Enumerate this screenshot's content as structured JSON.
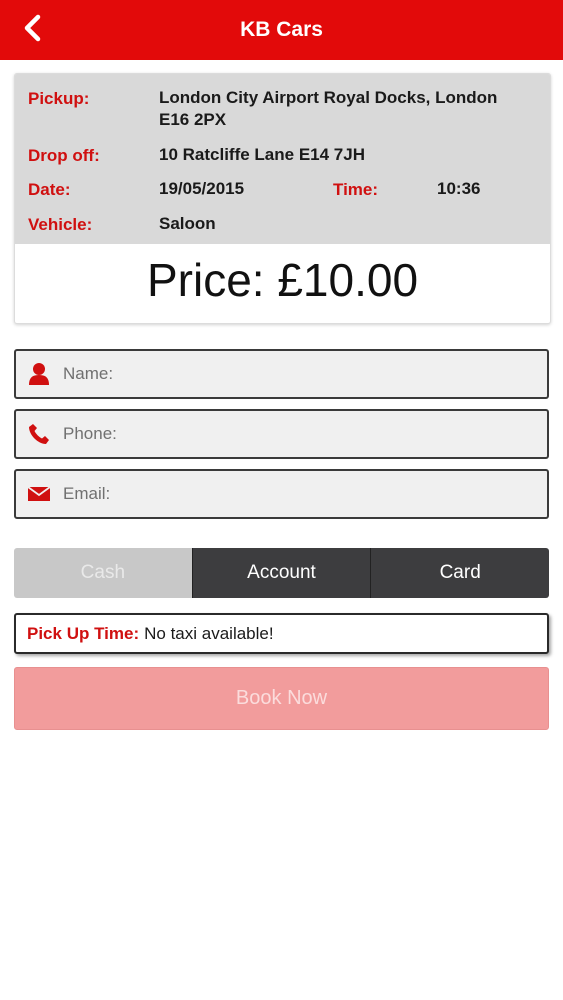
{
  "app": {
    "title": "KB Cars"
  },
  "summary": {
    "pickup_label": "Pickup:",
    "pickup_value_line1": "London City Airport Royal Docks, London",
    "pickup_value_line2": "E16 2PX",
    "dropoff_label": "Drop off:",
    "dropoff_value": "10 Ratcliffe Lane E14 7JH",
    "date_label": "Date:",
    "date_value": "19/05/2015",
    "time_label": "Time:",
    "time_value": "10:36",
    "vehicle_label": "Vehicle:",
    "vehicle_value": "Saloon",
    "price": "Price: £10.00"
  },
  "form": {
    "name_placeholder": "Name:",
    "phone_placeholder": "Phone:",
    "email_placeholder": "Email:",
    "name_value": "",
    "phone_value": "",
    "email_value": ""
  },
  "payment": {
    "options": [
      "Cash",
      "Account",
      "Card"
    ],
    "selected": "Cash"
  },
  "pickup_time": {
    "label": "Pick Up Time:",
    "value": "No taxi available!"
  },
  "book_button": {
    "label": "Book Now"
  },
  "colors": {
    "brand_red": "#e20a0a",
    "label_red": "#d01010",
    "book_button_disabled": "#f29c9c",
    "segment_dark": "#3d3d3f"
  },
  "icons": {
    "back": "chevron-left-icon",
    "name": "user-icon",
    "phone": "phone-icon",
    "email": "envelope-icon"
  }
}
